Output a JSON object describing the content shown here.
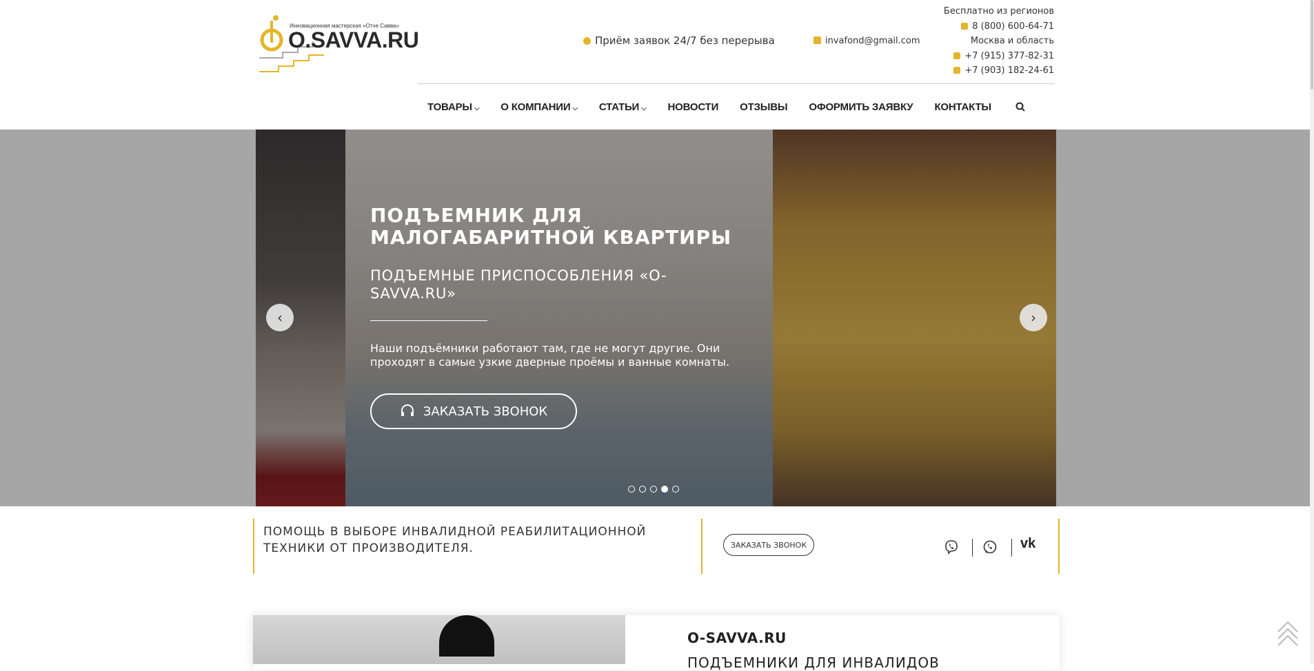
{
  "header": {
    "logo_tagline": "Инновационная мастерская «Отче Савва»",
    "logo_text": "O.SAVVA.RU",
    "hours_text": "Приём заявок 24/7 без перерыва",
    "email": "invafond@gmail.com",
    "contacts": {
      "free_label": "Бесплатно из регионов",
      "free_phone": "8 (800) 600-64-71",
      "moscow_label": "Москва и область",
      "phone_1": "+7 (915) 377-82-31",
      "phone_2": "+7 (903) 182-24-61"
    },
    "accent_color": "#e4b52a"
  },
  "nav": {
    "items": [
      {
        "label": "ТОВАРЫ",
        "has_dropdown": true
      },
      {
        "label": "О КОМПАНИИ",
        "has_dropdown": true
      },
      {
        "label": "СТАТЬИ",
        "has_dropdown": true
      },
      {
        "label": "НОВОСТИ",
        "has_dropdown": false
      },
      {
        "label": "ОТЗЫВЫ",
        "has_dropdown": false
      },
      {
        "label": "ОФОРМИТЬ ЗАЯВКУ",
        "has_dropdown": false
      },
      {
        "label": "КОНТАКТЫ",
        "has_dropdown": false
      }
    ],
    "search_icon": "search-icon"
  },
  "hero": {
    "title": "ПОДЪЕМНИК ДЛЯ МАЛОГАБАРИТНОЙ КВАРТИРЫ",
    "subtitle": "ПОДЪЕМНЫЕ ПРИСПОСОБЛЕНИЯ «O-SAVVA.RU»",
    "description": "Наши подъёмники работают там, где не могут другие. Они проходят в самые узкие дверные проёмы и ванные комнаты.",
    "button_label": "ЗАКАЗАТЬ ЗВОНОК",
    "slides_total": 5,
    "active_slide": 4
  },
  "infobar": {
    "text": "ПОМОЩЬ В ВЫБОРЕ ИНВАЛИДНОЙ РЕАБИЛИТАЦИОННОЙ ТЕХНИКИ ОТ ПРОИЗВОДИТЕЛЯ.",
    "button_label": "ЗАКАЗАТЬ ЗВОНОК",
    "social": [
      "viber-icon",
      "whatsapp-icon",
      "vk-icon"
    ],
    "vk_text": "vk"
  },
  "about": {
    "title": "O-SAVVA.RU",
    "subtitle": "ПОДЪЕМНИКИ ДЛЯ ИНВАЛИДОВ"
  }
}
